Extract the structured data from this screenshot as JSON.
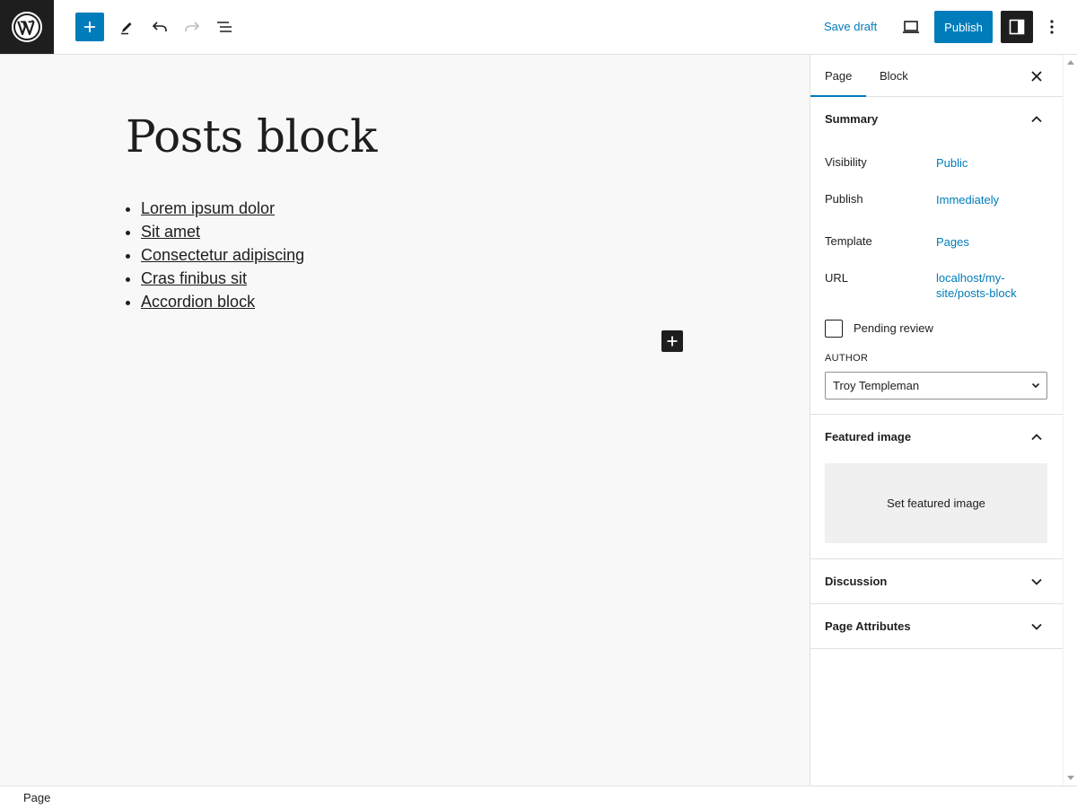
{
  "toolbar": {
    "save_draft_label": "Save draft",
    "publish_label": "Publish"
  },
  "editor": {
    "title": "Posts block",
    "list_items": [
      "Lorem ipsum dolor",
      "Sit amet",
      "Consectetur adipiscing",
      "Cras finibus sit",
      "Accordion block"
    ]
  },
  "sidebar": {
    "tabs": [
      "Page",
      "Block"
    ],
    "active_tab": "Page",
    "summary": {
      "title": "Summary",
      "visibility_label": "Visibility",
      "visibility_value": "Public",
      "publish_label": "Publish",
      "publish_value": "Immediately",
      "template_label": "Template",
      "template_value": "Pages",
      "url_label": "URL",
      "url_value": "localhost/my-site/posts-block",
      "pending_review_label": "Pending review",
      "pending_review_checked": false,
      "author_label": "AUTHOR",
      "author_value": "Troy Templeman"
    },
    "featured_image": {
      "title": "Featured image",
      "button_label": "Set featured image"
    },
    "discussion": {
      "title": "Discussion"
    },
    "page_attributes": {
      "title": "Page Attributes"
    }
  },
  "footer": {
    "breadcrumb": "Page"
  },
  "colors": {
    "accent": "#007cba",
    "dark": "#1e1e1e",
    "border": "#e0e0e0",
    "canvas_bg": "#f8f8f8"
  },
  "icons": {
    "logo": "wordpress-logo-icon",
    "add": "plus-icon",
    "tools": "pencil-icon",
    "undo": "undo-icon",
    "redo": "redo-icon",
    "outline": "list-view-icon",
    "preview": "laptop-icon",
    "settings": "sidebar-icon",
    "options": "more-vertical-icon",
    "close": "close-icon"
  }
}
